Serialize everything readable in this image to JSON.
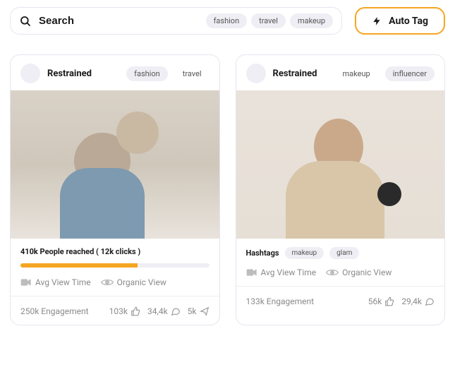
{
  "search": {
    "placeholder": "Search",
    "chips": [
      "fashion",
      "travel",
      "makeup"
    ]
  },
  "auto_tag_label": "Auto Tag",
  "cards": [
    {
      "username": "Restrained",
      "tags": [
        {
          "text": "fashion",
          "style": "chip"
        },
        {
          "text": "travel",
          "style": "plain"
        }
      ],
      "reach_line": "410k People reached ( 12k clicks )",
      "progress_pct": 62,
      "avg_view": "Avg View Time",
      "organic_view": "Organic View",
      "engagement": "250k Engagement",
      "likes": "103k",
      "comments": "34,4k",
      "shares": "5k"
    },
    {
      "username": "Restrained",
      "tags": [
        {
          "text": "makeup",
          "style": "plain"
        },
        {
          "text": "influencer",
          "style": "chip"
        }
      ],
      "hashtags_label": "Hashtags",
      "hashtags": [
        "makeup",
        "glam"
      ],
      "avg_view": "Avg View Time",
      "organic_view": "Organic View",
      "engagement": "133k Engagement",
      "likes": "56k",
      "comments": "29,4k"
    }
  ]
}
